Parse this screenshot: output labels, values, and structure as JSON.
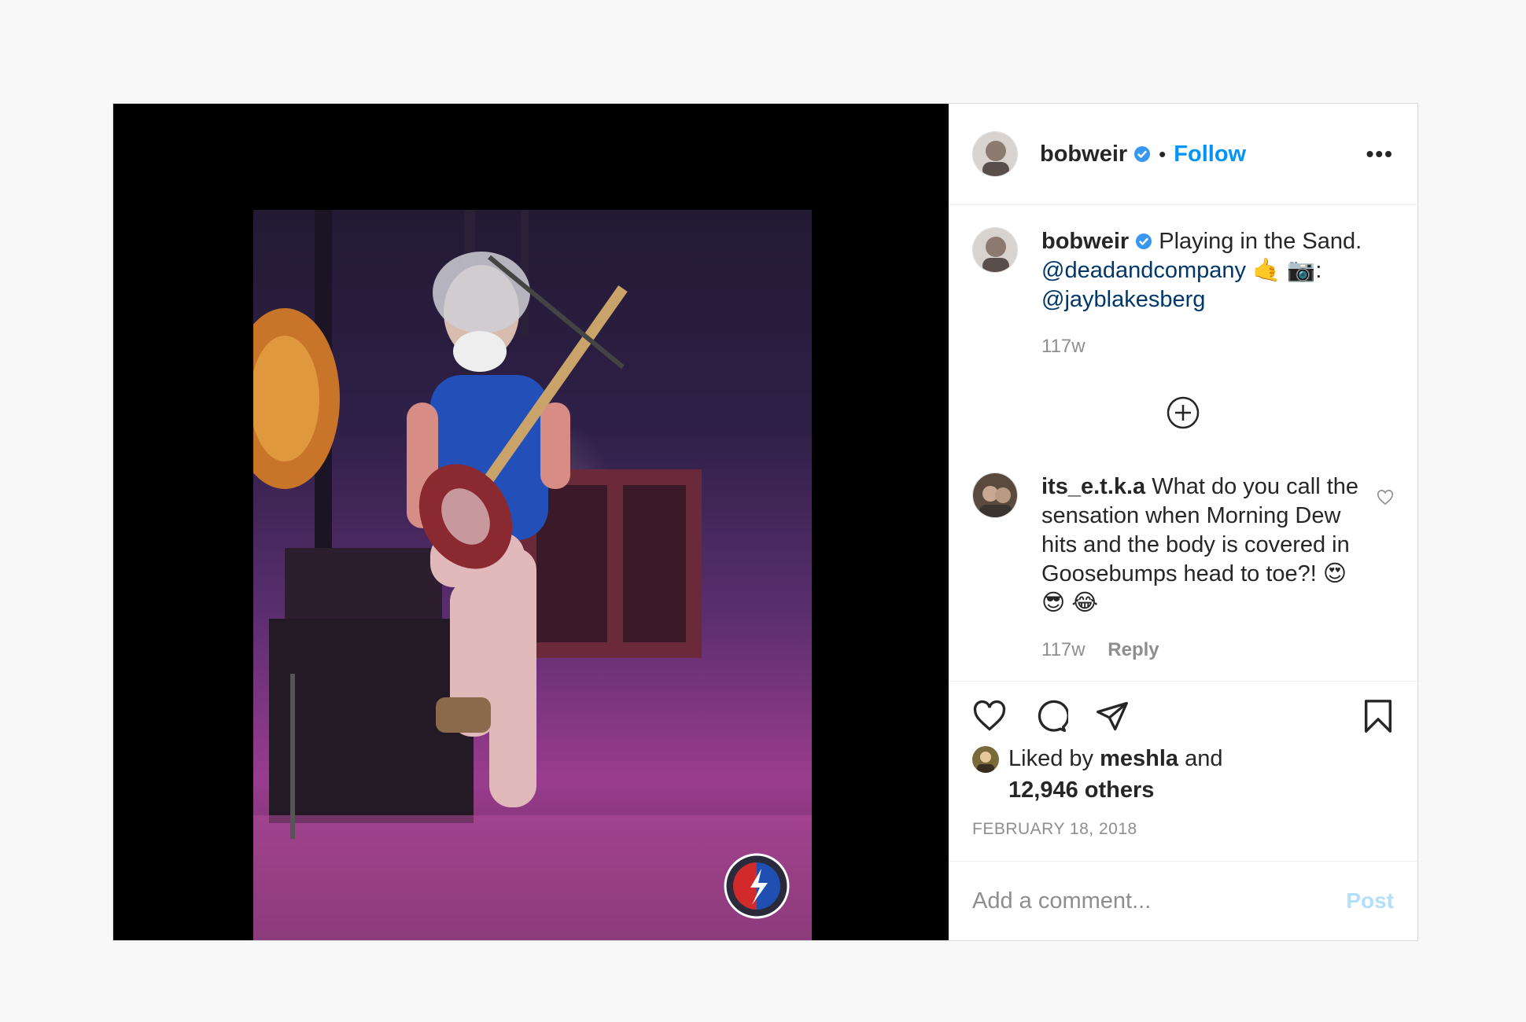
{
  "header": {
    "username": "bobweir",
    "separator": "•",
    "follow_label": "Follow",
    "more_label": "•••"
  },
  "caption": {
    "username": "bobweir",
    "text_before": "Playing in the Sand.",
    "mention_1": "@deadandcompany",
    "emoji_1": "🤙 📷:",
    "mention_2": "@jayblakesberg",
    "age": "117w"
  },
  "comment": {
    "username": "its_e.t.k.a",
    "text": "What do you call the sensation when Morning Dew hits and the body is covered in Goosebumps head to toe?!",
    "emoji": "😍 😎 😂",
    "age": "117w",
    "reply_label": "Reply"
  },
  "likes": {
    "prefix": "Liked by",
    "user": "meshla",
    "conj": "and",
    "others": "12,946 others"
  },
  "date": "FEBRUARY 18, 2018",
  "add_comment": {
    "placeholder": "Add a comment...",
    "post_label": "Post"
  },
  "colors": {
    "link": "#0095f6",
    "post_disabled": "#b2dffc",
    "mention": "#00376b"
  },
  "icons": [
    "verified-badge-icon",
    "more-icon",
    "load-more-icon",
    "heart-icon",
    "comment-icon",
    "share-icon",
    "bookmark-icon"
  ]
}
